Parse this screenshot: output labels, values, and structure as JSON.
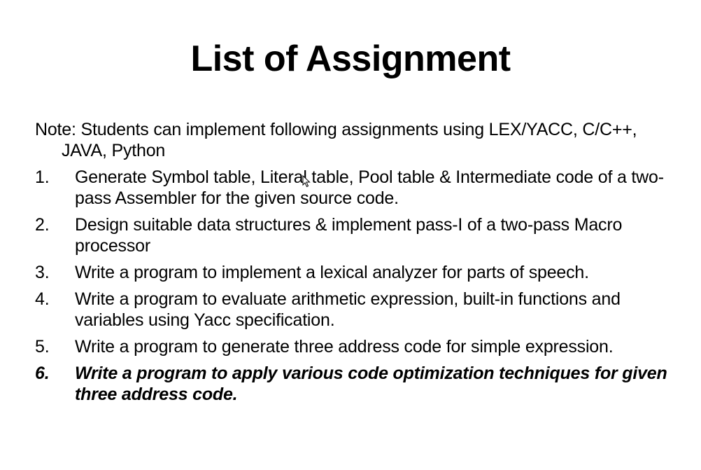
{
  "slide": {
    "title": "List of Assignment",
    "note": "Note: Students can implement following assignments using LEX/YACC, C/C++, JAVA, Python",
    "items": [
      {
        "number": "1.",
        "text": "Generate Symbol table, Literal table, Pool table & Intermediate code of a two-pass Assembler for the given source code."
      },
      {
        "number": "2.",
        "text": "Design suitable data structures & implement pass-I of a two-pass Macro processor"
      },
      {
        "number": "3.",
        "text": "Write a program to implement a lexical analyzer for parts of speech."
      },
      {
        "number": "4.",
        "text": "Write a program to evaluate arithmetic expression, built-in functions and variables using Yacc specification."
      },
      {
        "number": "5.",
        "text": "Write a program to generate three address code for simple expression."
      },
      {
        "number": "6.",
        "text": "Write a program to apply various code optimization techniques for given three address code."
      }
    ],
    "emphasized_item": "6.",
    "cursor_icon": "mouse-pointer-icon"
  }
}
